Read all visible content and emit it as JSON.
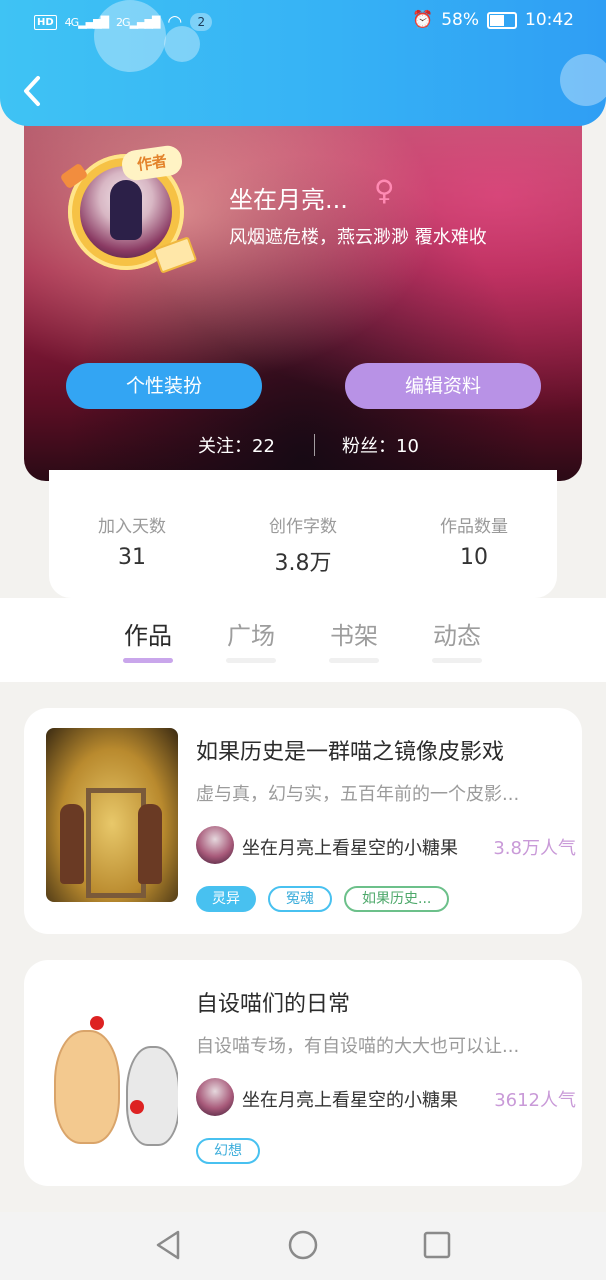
{
  "status_bar": {
    "hd": "HD",
    "sig1": "4G",
    "sig2": "2G",
    "notif_count": "2",
    "battery": "58%",
    "time": "10:42"
  },
  "icons": {
    "back": "back-arrow",
    "gender": "female-symbol",
    "nav_back": "triangle-back",
    "nav_home": "circle-home",
    "nav_recent": "square-recent"
  },
  "profile": {
    "username": "坐在月亮...",
    "gender_symbol": "♀",
    "motto": "风烟遮危楼，燕云渺渺 覆水难收",
    "author_tag": "作者",
    "dress_button": "个性装扮",
    "edit_button": "编辑资料",
    "following": "关注：22",
    "fans": "粉丝：10"
  },
  "stats": [
    {
      "label": "加入天数",
      "value": "31"
    },
    {
      "label": "创作字数",
      "value": "3.8万"
    },
    {
      "label": "作品数量",
      "value": "10"
    }
  ],
  "tabs": [
    {
      "label": "作品",
      "active": true
    },
    {
      "label": "广场",
      "active": false
    },
    {
      "label": "书架",
      "active": false
    },
    {
      "label": "动态",
      "active": false
    }
  ],
  "works": [
    {
      "title": "如果历史是一群喵之镜像皮影戏",
      "desc": "虚与真，幻与实，五百年前的一个皮影...",
      "author": "坐在月亮上看星空的小糖果",
      "popularity": "3.8万人气",
      "tags": [
        "灵异",
        "冤魂",
        "如果历史..."
      ]
    },
    {
      "title": "自设喵们的日常",
      "desc": "自设喵专场，有自设喵的大大也可以让...",
      "author": "坐在月亮上看星空的小糖果",
      "popularity": "3612人气",
      "tags": [
        "幻想"
      ]
    }
  ],
  "colors": {
    "header": "#36b2f5",
    "dress_btn": "#33a5f3",
    "edit_btn": "#b892e6",
    "tab_indicator": "#c9a6eb",
    "popularity": "#c99ad8"
  }
}
